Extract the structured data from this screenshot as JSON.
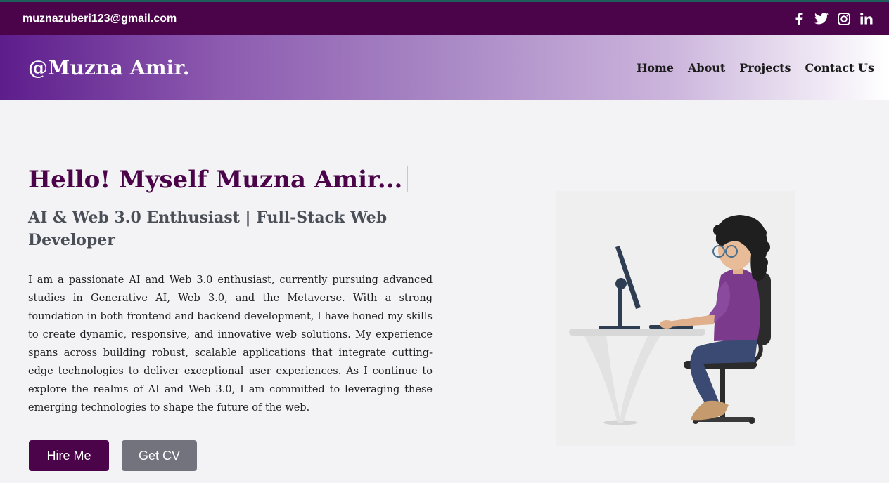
{
  "topbar": {
    "email": "muznazuberi123@gmail.com",
    "socials": [
      {
        "icon": "facebook-icon",
        "glyph": "f"
      },
      {
        "icon": "twitter-icon",
        "glyph": ""
      },
      {
        "icon": "instagram-icon",
        "glyph": ""
      },
      {
        "icon": "linkedin-icon",
        "glyph": "in"
      }
    ]
  },
  "navbar": {
    "brand": "@Muzna Amir.",
    "links": [
      "Home",
      "About",
      "Projects",
      "Contact Us"
    ]
  },
  "hero": {
    "title": "Hello! Myself Muzna Amir...",
    "subtitle": "AI & Web 3.0 Enthusiast | Full-Stack Web Developer",
    "description": "I am a passionate AI and Web 3.0 enthusiast, currently pursuing advanced studies in Generative AI, Web 3.0, and the Metaverse. With a strong foundation in both frontend and backend development, I have honed my skills to create dynamic, responsive, and innovative web solutions. My experience spans across building robust, scalable applications that integrate cutting-edge technologies to deliver exceptional user experiences. As I continue to explore the realms of AI and Web 3.0, I am committed to leveraging these emerging technologies to shape the future of the web.",
    "hire_label": "Hire Me",
    "cv_label": "Get CV"
  },
  "colors": {
    "brand_dark": "#4b044a",
    "nav_gradient_start": "#5d1d8c",
    "button_gray": "#72737d"
  }
}
